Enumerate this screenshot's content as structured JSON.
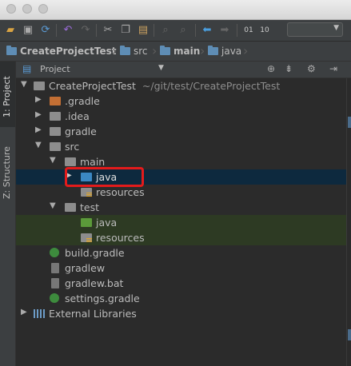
{
  "toolbar": {
    "icons": [
      "open-folder-icon",
      "save-icon",
      "sync-icon",
      "undo-icon",
      "redo-icon",
      "cut-icon",
      "copy-icon",
      "paste-icon",
      "find-icon",
      "replace-icon",
      "back-icon",
      "forward-icon",
      "build-icon"
    ],
    "run_config_value": ""
  },
  "breadcrumb": [
    {
      "label": "CreateProjectTest",
      "bold": true
    },
    {
      "label": "src",
      "bold": false
    },
    {
      "label": "main",
      "bold": true
    },
    {
      "label": "java",
      "bold": false
    }
  ],
  "side_tabs": {
    "project": "1: Project",
    "structure": "Z: Structure"
  },
  "panel": {
    "title": "Project",
    "icons": [
      "target-icon",
      "collapse-icon",
      "settings-icon",
      "hide-icon"
    ]
  },
  "tree": {
    "root": {
      "label": "CreateProjectTest",
      "path": "~/git/test/CreateProjectTest"
    },
    "items": [
      {
        "label": ".gradle"
      },
      {
        "label": ".idea"
      },
      {
        "label": "gradle"
      },
      {
        "label": "src"
      },
      {
        "label": "main"
      },
      {
        "label": "java"
      },
      {
        "label": "resources"
      },
      {
        "label": "test"
      },
      {
        "label": "java"
      },
      {
        "label": "resources"
      },
      {
        "label": "build.gradle"
      },
      {
        "label": "gradlew"
      },
      {
        "label": "gradlew.bat"
      },
      {
        "label": "settings.gradle"
      },
      {
        "label": "External Libraries"
      }
    ]
  },
  "colors": {
    "accent_selection": "#0d293e",
    "highlight_box": "#e31b1b",
    "folder_blue": "#3b88c3",
    "folder_green": "#5b9a3a"
  }
}
